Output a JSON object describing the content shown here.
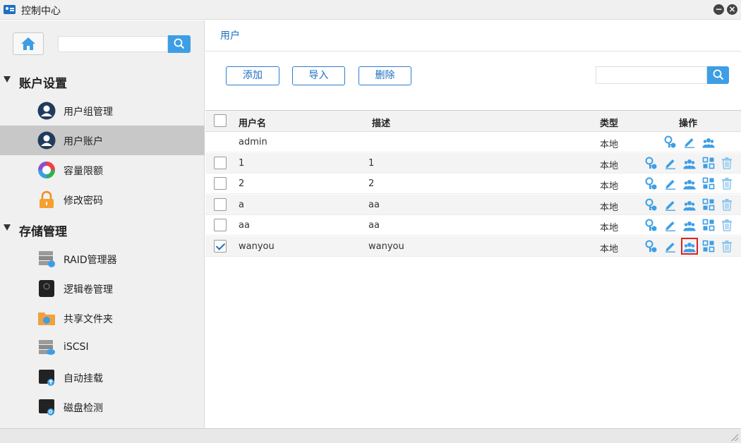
{
  "window": {
    "title": "控制中心"
  },
  "sidebar": {
    "groups": [
      {
        "label": "账户设置",
        "items": [
          {
            "label": "用户组管理",
            "icon": "user-group-icon",
            "active": false
          },
          {
            "label": "用户账户",
            "icon": "user-account-icon",
            "active": true
          },
          {
            "label": "容量限额",
            "icon": "quota-icon",
            "active": false
          },
          {
            "label": "修改密码",
            "icon": "lock-icon",
            "active": false
          }
        ]
      },
      {
        "label": "存储管理",
        "items": [
          {
            "label": "RAID管理器",
            "icon": "raid-icon",
            "active": false
          },
          {
            "label": "逻辑卷管理",
            "icon": "volume-icon",
            "active": false
          },
          {
            "label": "共享文件夹",
            "icon": "shared-folder-icon",
            "active": false
          },
          {
            "label": "iSCSI",
            "icon": "iscsi-icon",
            "active": false
          },
          {
            "label": "自动挂载",
            "icon": "automount-icon",
            "active": false
          },
          {
            "label": "磁盘检测",
            "icon": "disk-check-icon",
            "active": false
          }
        ]
      }
    ]
  },
  "main": {
    "breadcrumb": "用户",
    "toolbar": {
      "add_label": "添加",
      "import_label": "导入",
      "delete_label": "删除"
    },
    "table": {
      "columns": {
        "username": "用户名",
        "desc": "描述",
        "type": "类型",
        "actions": "操作"
      },
      "rows": [
        {
          "username": "admin",
          "desc": "",
          "type": "本地",
          "checkbox": false,
          "checked": false
        },
        {
          "username": "1",
          "desc": "1",
          "type": "本地",
          "checkbox": true,
          "checked": false
        },
        {
          "username": "2",
          "desc": "2",
          "type": "本地",
          "checkbox": true,
          "checked": false
        },
        {
          "username": "a",
          "desc": "aa",
          "type": "本地",
          "checkbox": true,
          "checked": false
        },
        {
          "username": "aa",
          "desc": "aa",
          "type": "本地",
          "checkbox": true,
          "checked": false
        },
        {
          "username": "wanyou",
          "desc": "wanyou",
          "type": "本地",
          "checkbox": true,
          "checked": true
        }
      ]
    }
  },
  "colors": {
    "accent": "#1e6fc0",
    "icon_blue": "#3d9ee5",
    "highlight": "#e02020"
  }
}
